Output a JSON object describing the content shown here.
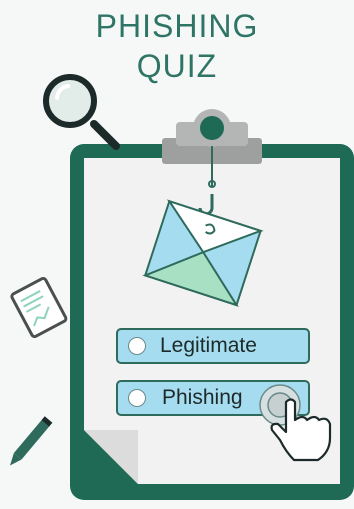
{
  "quiz": {
    "title_line1": "PHISHING",
    "title_line2": "QUIZ",
    "options": [
      {
        "label": "Legitimate",
        "selected": false
      },
      {
        "label": "Phishing",
        "selected": false
      }
    ]
  },
  "colors": {
    "title": "#2e7566",
    "clipboard_frame": "#1f6a55",
    "paper": "#f2f2f2",
    "option_fill": "#a6dcef",
    "option_border": "#2f6b5d",
    "envelope_blue": "#a6dcef",
    "envelope_green": "#a8e0c4"
  },
  "icons": [
    "magnifying-glass-icon",
    "clipboard-clip-icon",
    "fish-hook-icon",
    "envelope-icon",
    "document-icon",
    "pencil-icon",
    "pointer-hand-icon"
  ]
}
